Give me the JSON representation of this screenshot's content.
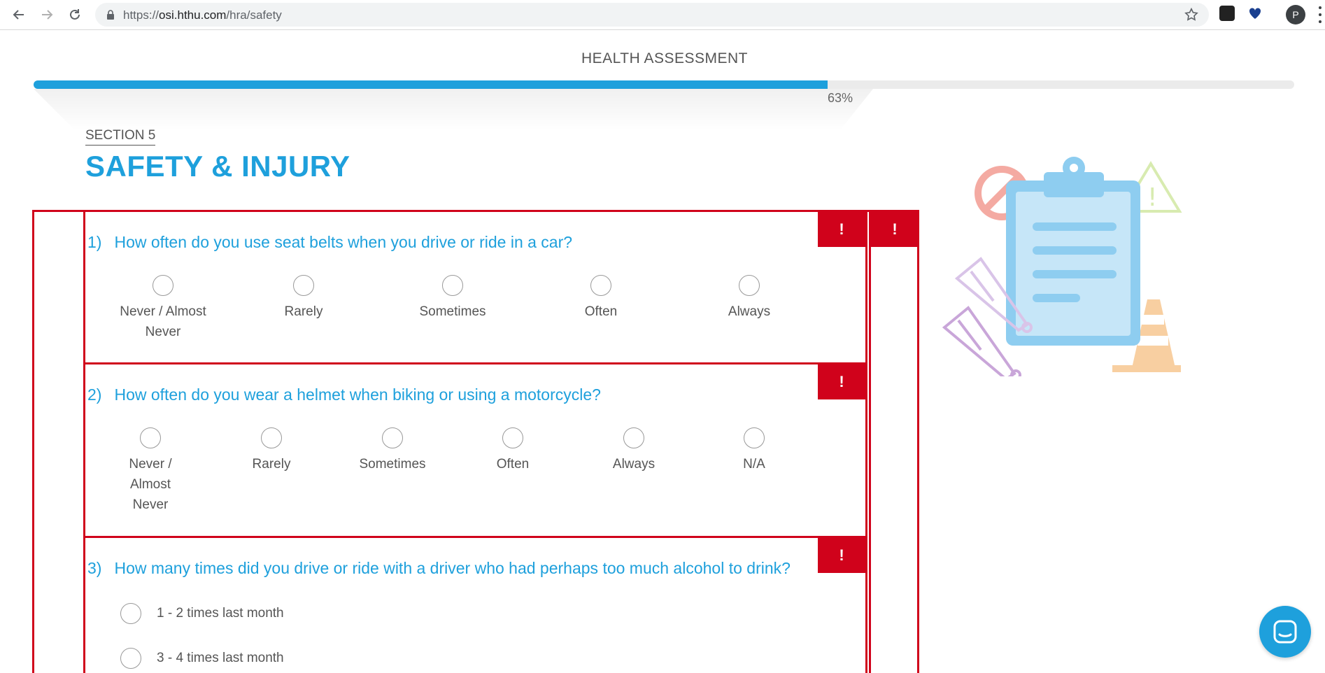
{
  "browser": {
    "url_scheme": "https://",
    "url_host": "osi.hthu.com",
    "url_path": "/hra/safety",
    "profile_initial": "P"
  },
  "header": {
    "title": "HEALTH ASSESSMENT",
    "progress_percent": 63,
    "progress_label": "63%"
  },
  "section": {
    "label": "SECTION 5",
    "title": "SAFETY & INJURY"
  },
  "flag_symbol": "!",
  "questions": [
    {
      "number": "1)",
      "text": "How often do you use seat belts when you drive or ride in a car?",
      "options": [
        "Never / Almost Never",
        "Rarely",
        "Sometimes",
        "Often",
        "Always"
      ]
    },
    {
      "number": "2)",
      "text": "How often do you wear a helmet when biking or using a motorcycle?",
      "options": [
        "Never / Almost Never",
        "Rarely",
        "Sometimes",
        "Often",
        "Always",
        "N/A"
      ]
    },
    {
      "number": "3)",
      "text": "How many times did you drive or ride with a driver who had perhaps too much alcohol to drink?",
      "options": [
        "1 - 2 times last month",
        "3 - 4 times last month"
      ]
    }
  ],
  "colors": {
    "accent": "#1ea0dc",
    "error": "#d0021b",
    "text": "#555555"
  },
  "icons": [
    "back-icon",
    "forward-icon",
    "reload-icon",
    "lock-icon",
    "star-icon",
    "chat-icon"
  ]
}
